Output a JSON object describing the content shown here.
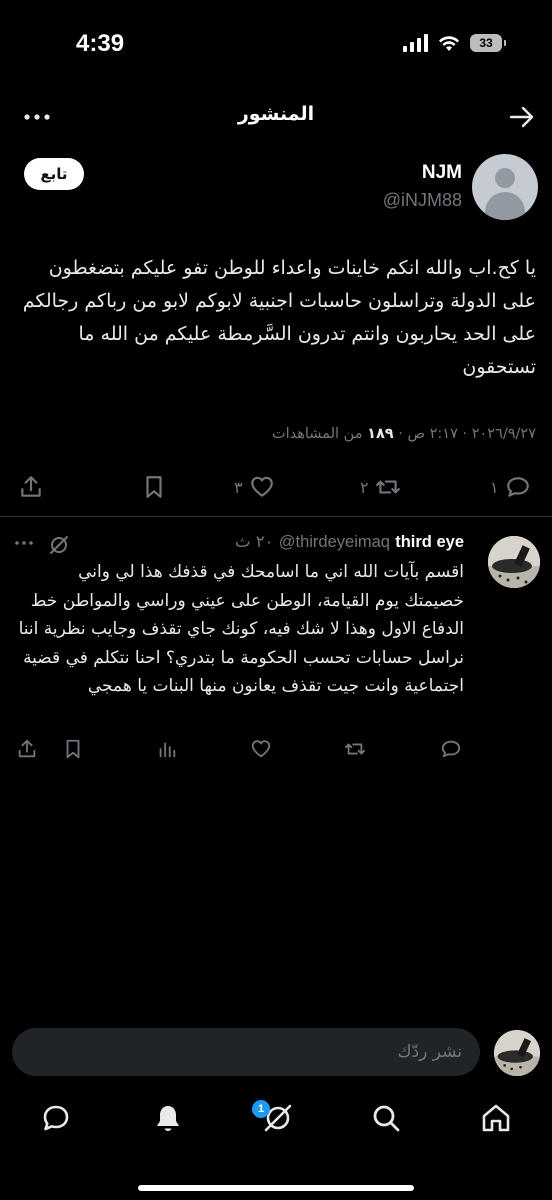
{
  "status_bar": {
    "time": "4:39",
    "battery": "33"
  },
  "header": {
    "title": "المنشور"
  },
  "post": {
    "display_name": "NJM",
    "handle": "@iNJM88",
    "follow_label": "تابع",
    "text": "يا كح.اب والله انكم خاينات واعداء للوطن تفو عليكم بتضغطون على الدولة وتراسلون حاسبات اجنبية لابوكم لابو من رباكم رجالكم على الحد يحاربون وانتم تدرون السَّرمطة عليكم من الله ما تستحقون",
    "timestamp": "٢٠٢٦/٩/٢٧ · ٢:١٧ ص",
    "views_count": "١٨٩",
    "views_label": "من المشاهدات",
    "reply_count": "١",
    "repost_count": "٢",
    "like_count": "٣"
  },
  "reply": {
    "display_name": "third eye",
    "handle": "@thirdeyeimaq",
    "time": "٢٠ ث",
    "text": "اقسم بآيات الله اني ما اسامحك في قذفك هذا لي واني خصيمتك يوم القيامة، الوطن على عيني وراسي والمواطن خط الدفاع الاول وهذا لا شك فيه، كونك جاي تقذف وجايب نظرية اننا نراسل حسابات تحسب الحكومة ما بتدري؟ احنا نتكلم في قضية اجتماعية وانت جيت تقذف يعانون منها البنات يا همجي"
  },
  "compose": {
    "placeholder": "نشر ردّك"
  },
  "bottom_nav": {
    "notifications_badge": "1"
  },
  "icons": [
    "back-arrow-icon",
    "more-icon",
    "reply-icon",
    "repost-icon",
    "like-icon",
    "bookmark-icon",
    "share-icon",
    "views-icon",
    "grok-icon",
    "home-icon",
    "search-icon",
    "grok-nav-icon",
    "notifications-icon",
    "messages-icon"
  ],
  "colors": {
    "background": "#000000",
    "text": "#e7e9ea",
    "muted": "#71767b",
    "accent": "#1d9bf0",
    "divider": "#2f3336"
  }
}
